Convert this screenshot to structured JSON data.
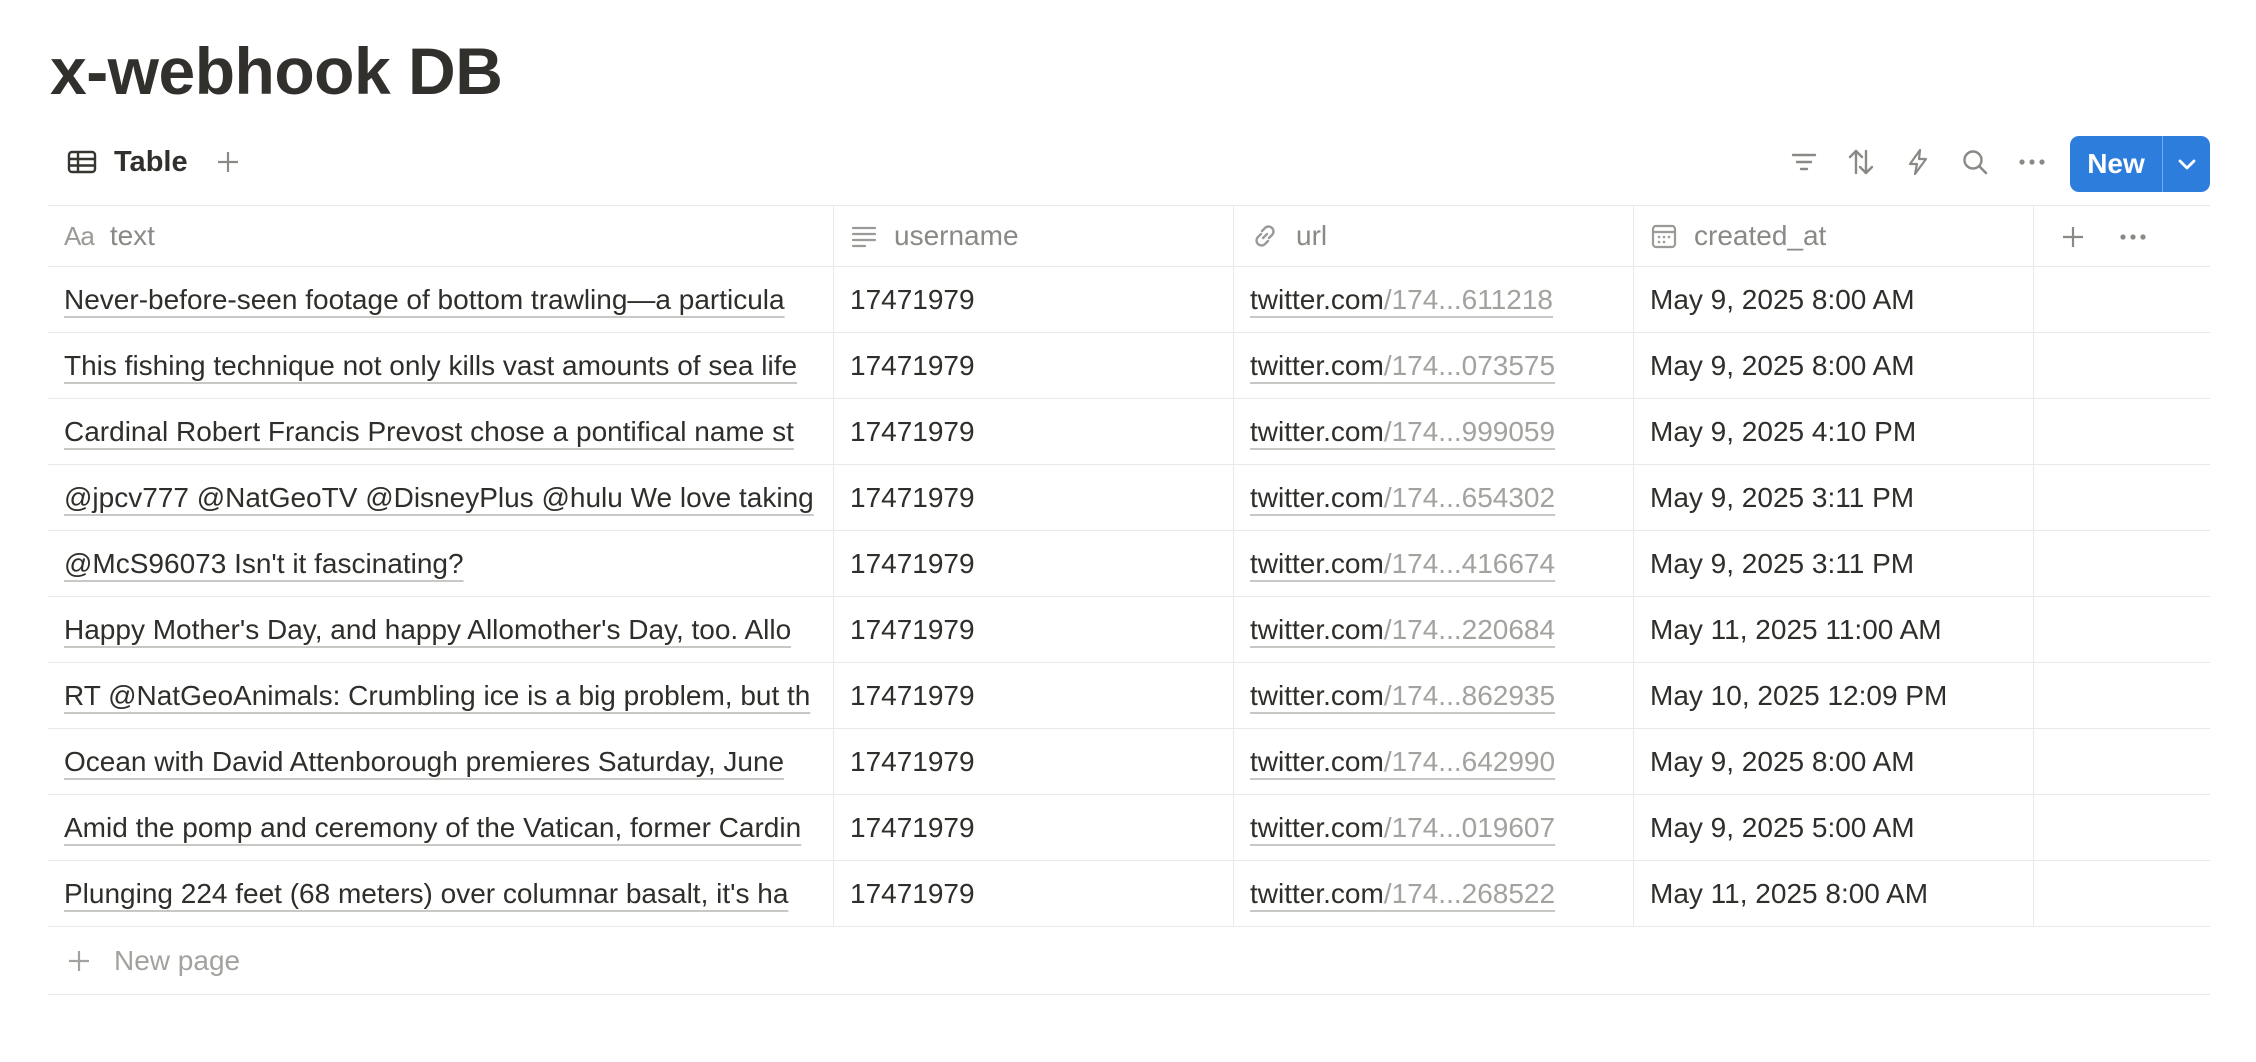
{
  "page": {
    "title": "x-webhook DB"
  },
  "view": {
    "tab_label": "Table",
    "new_button_label": "New"
  },
  "columns": {
    "text": {
      "label": "text",
      "type_glyph": "Aa"
    },
    "username": {
      "label": "username"
    },
    "url": {
      "label": "url"
    },
    "created_at": {
      "label": "created_at"
    }
  },
  "rows": [
    {
      "text": "Never-before-seen footage of bottom trawling—a particula",
      "username": "17471979",
      "url_host": "twitter.com",
      "url_path": "/174...611218",
      "created_at": "May 9, 2025 8:00 AM"
    },
    {
      "text": "This fishing technique not only kills vast amounts of sea life",
      "username": "17471979",
      "url_host": "twitter.com",
      "url_path": "/174...073575",
      "created_at": "May 9, 2025 8:00 AM"
    },
    {
      "text": "Cardinal Robert Francis Prevost chose a pontifical name st",
      "username": "17471979",
      "url_host": "twitter.com",
      "url_path": "/174...999059",
      "created_at": "May 9, 2025 4:10 PM"
    },
    {
      "text": "@jpcv777 @NatGeoTV @DisneyPlus @hulu We love taking",
      "username": "17471979",
      "url_host": "twitter.com",
      "url_path": "/174...654302",
      "created_at": "May 9, 2025 3:11 PM"
    },
    {
      "text": "@McS96073 Isn't it fascinating?",
      "username": "17471979",
      "url_host": "twitter.com",
      "url_path": "/174...416674",
      "created_at": "May 9, 2025 3:11 PM"
    },
    {
      "text": "Happy Mother's Day, and happy Allomother's Day, too. Allo",
      "username": "17471979",
      "url_host": "twitter.com",
      "url_path": "/174...220684",
      "created_at": "May 11, 2025 11:00 AM"
    },
    {
      "text": "RT @NatGeoAnimals: Crumbling ice is a big problem, but th",
      "username": "17471979",
      "url_host": "twitter.com",
      "url_path": "/174...862935",
      "created_at": "May 10, 2025 12:09 PM"
    },
    {
      "text": "Ocean with David Attenborough premieres Saturday, June",
      "username": "17471979",
      "url_host": "twitter.com",
      "url_path": "/174...642990",
      "created_at": "May 9, 2025 8:00 AM"
    },
    {
      "text": "Amid the pomp and ceremony of the Vatican, former Cardin",
      "username": "17471979",
      "url_host": "twitter.com",
      "url_path": "/174...019607",
      "created_at": "May 9, 2025 5:00 AM"
    },
    {
      "text": "Plunging 224 feet (68 meters) over columnar basalt, it's ha",
      "username": "17471979",
      "url_host": "twitter.com",
      "url_path": "/174...268522",
      "created_at": "May 11, 2025 8:00 AM"
    }
  ],
  "footer": {
    "new_page_label": "New page"
  },
  "icons": {
    "view_tab": "table-icon",
    "add_view": "plus-icon",
    "toolbar": [
      "filter-icon",
      "sort-icon",
      "automation-bolt-icon",
      "search-icon",
      "more-icon"
    ],
    "new_dropdown": "chevron-down-icon",
    "username_column": "text-lines-icon",
    "url_column": "link-icon",
    "created_at_column": "calendar-icon",
    "add_property": "plus-icon",
    "column_more": "more-icon"
  },
  "colors": {
    "accent": "#2c7ddc",
    "title": "#32302c",
    "muted": "#8a8985",
    "border": "#e9e9e7"
  }
}
